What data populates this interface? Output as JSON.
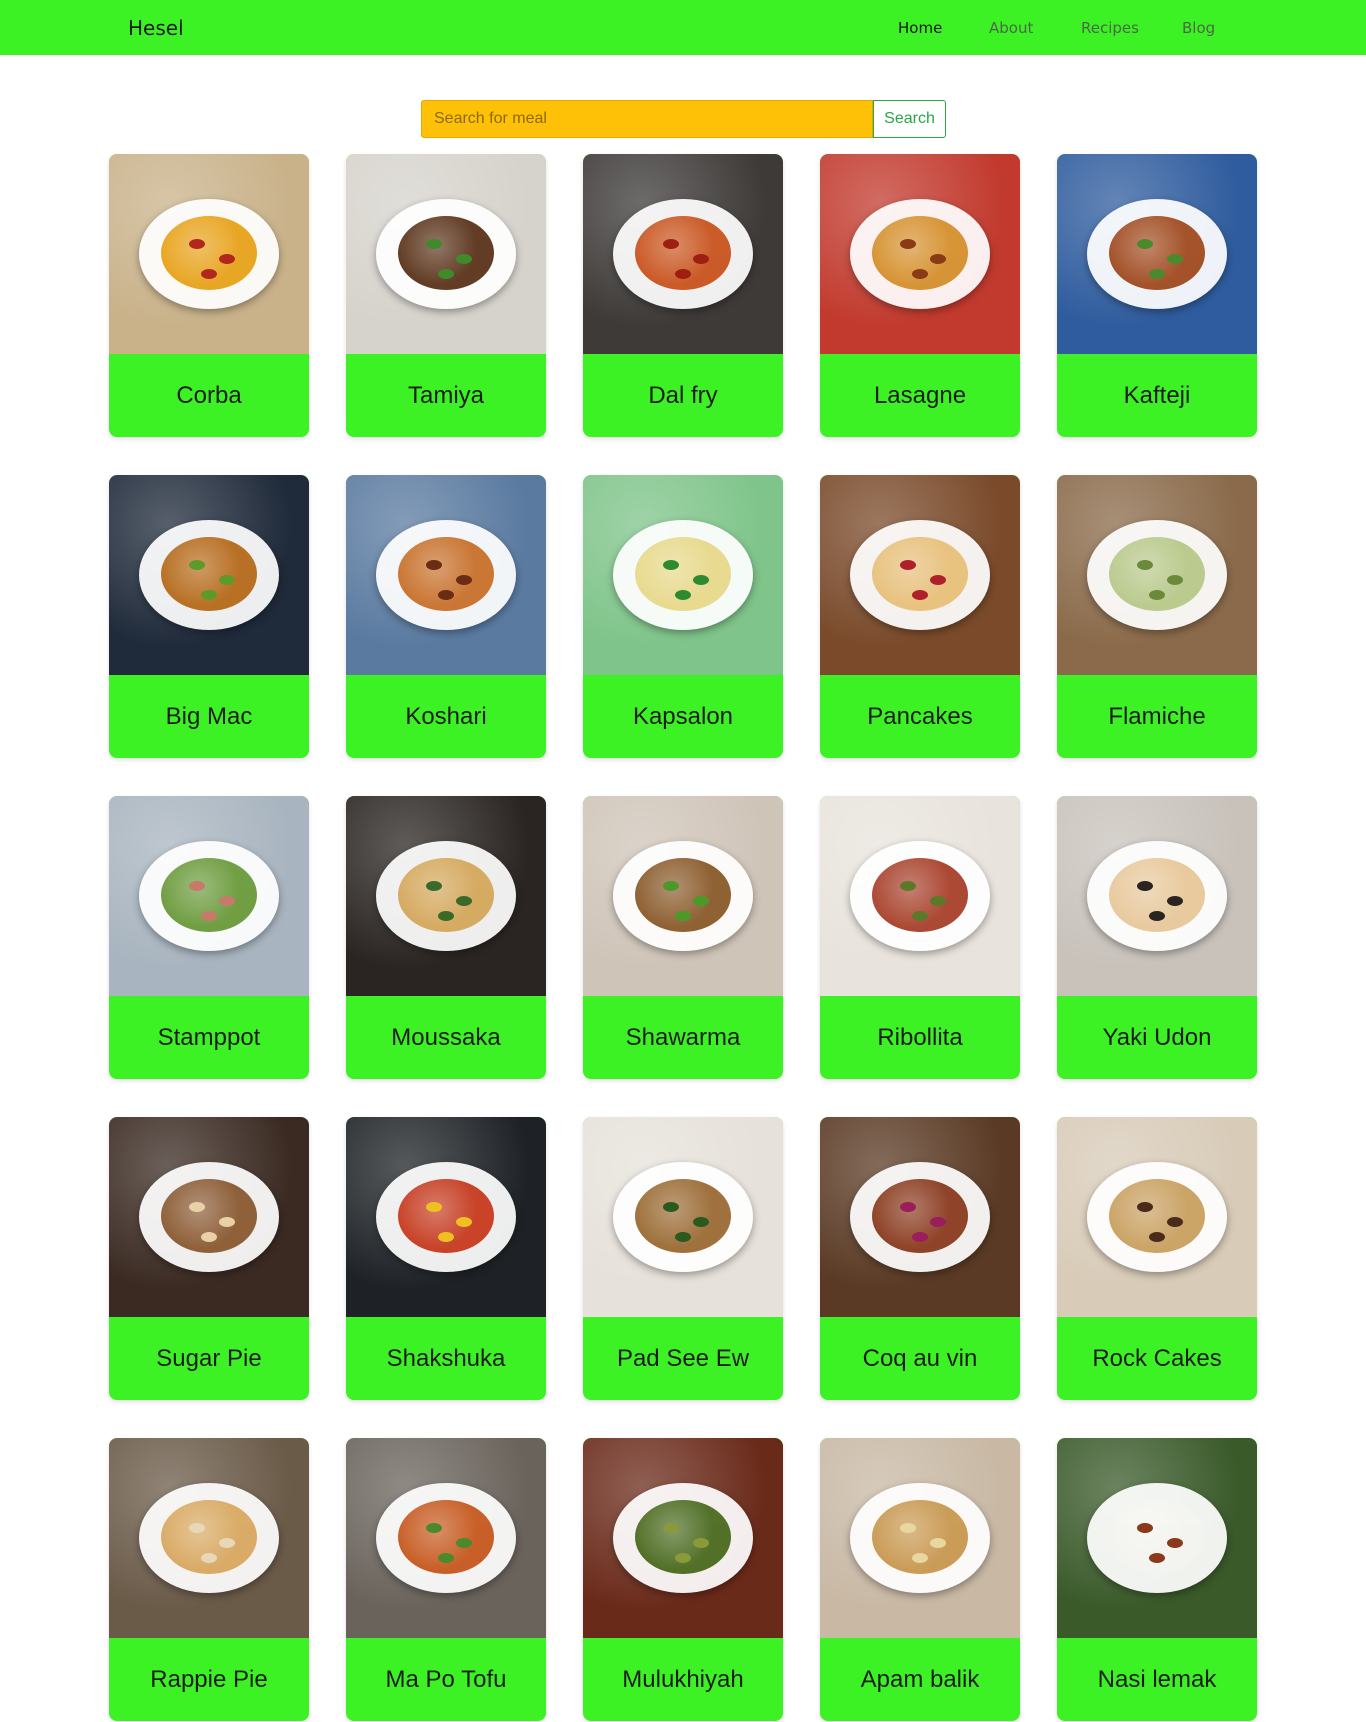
{
  "navbar": {
    "brand": "Hesel",
    "links": [
      {
        "label": "Home",
        "active": true
      },
      {
        "label": "About",
        "active": false
      },
      {
        "label": "Recipes",
        "active": false
      },
      {
        "label": "Blog",
        "active": false
      }
    ]
  },
  "search": {
    "placeholder": "Search for meal",
    "button_label": "Search"
  },
  "colors": {
    "accent_green": "#3cf224",
    "search_yellow": "#ffc107",
    "button_outline": "#28a745"
  },
  "meals": [
    {
      "name": "Corba",
      "bg": "#c9b28a",
      "food": "#e8a21a",
      "garnish": "#b3261e"
    },
    {
      "name": "Tamiya",
      "bg": "#d6d3cc",
      "food": "#5a3219",
      "garnish": "#3f8a2a"
    },
    {
      "name": "Dal fry",
      "bg": "#3d3a38",
      "food": "#c9531d",
      "garnish": "#9e1e12"
    },
    {
      "name": "Lasagne",
      "bg": "#c23a2e",
      "food": "#d6902d",
      "garnish": "#8a3a14"
    },
    {
      "name": "Kafteji",
      "bg": "#2f5c9e",
      "food": "#a04a1f",
      "garnish": "#4b8a2c"
    },
    {
      "name": "Big Mac",
      "bg": "#1f2a3a",
      "food": "#b66a1a",
      "garnish": "#5d9a2a"
    },
    {
      "name": "Koshari",
      "bg": "#5a7aa0",
      "food": "#c8702a",
      "garnish": "#6a2c12"
    },
    {
      "name": "Kapsalon",
      "bg": "#7fc48a",
      "food": "#e8d98a",
      "garnish": "#2e8a30"
    },
    {
      "name": "Pancakes",
      "bg": "#7a4a2a",
      "food": "#e8c07a",
      "garnish": "#b0202a"
    },
    {
      "name": "Flamiche",
      "bg": "#8a6a4a",
      "food": "#b8c98a",
      "garnish": "#6a8a3a"
    },
    {
      "name": "Stamppot",
      "bg": "#a8b4bf",
      "food": "#6a9a3a",
      "garnish": "#c87a6a"
    },
    {
      "name": "Moussaka",
      "bg": "#2a2522",
      "food": "#d4a75a",
      "garnish": "#3a6a2a"
    },
    {
      "name": "Shawarma",
      "bg": "#cfc4b8",
      "food": "#8a5a2a",
      "garnish": "#4a9a2a"
    },
    {
      "name": "Ribollita",
      "bg": "#e8e3dc",
      "food": "#a8402a",
      "garnish": "#5a7a2a"
    },
    {
      "name": "Yaki Udon",
      "bg": "#c8c2bb",
      "food": "#e8c89a",
      "garnish": "#2a2520"
    },
    {
      "name": "Sugar Pie",
      "bg": "#3a2a22",
      "food": "#8a5a32",
      "garnish": "#e8d0a8"
    },
    {
      "name": "Shakshuka",
      "bg": "#1e2226",
      "food": "#c63a1e",
      "garnish": "#f0c020"
    },
    {
      "name": "Pad See Ew",
      "bg": "#e6e1da",
      "food": "#9a6a32",
      "garnish": "#2a5a1e"
    },
    {
      "name": "Coq au vin",
      "bg": "#5a3a24",
      "food": "#8a3a1e",
      "garnish": "#9a1e5a"
    },
    {
      "name": "Rock Cakes",
      "bg": "#d8cbb8",
      "food": "#c9a060",
      "garnish": "#4a2a1a"
    },
    {
      "name": "Rappie Pie",
      "bg": "#6a5a48",
      "food": "#d8a860",
      "garnish": "#e8d8b8"
    },
    {
      "name": "Ma Po Tofu",
      "bg": "#6a635c",
      "food": "#c6581e",
      "garnish": "#4a8a2a"
    },
    {
      "name": "Mulukhiyah",
      "bg": "#6a2a1a",
      "food": "#4a6a1e",
      "garnish": "#8a9a3a"
    },
    {
      "name": "Apam balik",
      "bg": "#c8b8a4",
      "food": "#c89850",
      "garnish": "#e8d8a0"
    },
    {
      "name": "Nasi lemak",
      "bg": "#3a5a2a",
      "food": "#f4f4f0",
      "garnish": "#8a3a1a"
    }
  ]
}
